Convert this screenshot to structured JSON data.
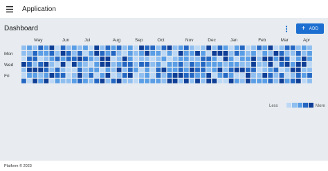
{
  "app": {
    "title": "Application",
    "menu_icon": "menu-icon"
  },
  "dashboard": {
    "title": "Dashboard",
    "more_icon": "more-vert-icon",
    "add_button": {
      "label": "ADD",
      "icon": "plus-icon",
      "color": "#1c6fd0"
    }
  },
  "heatmap": {
    "months": [
      "May",
      "Jun",
      "Jul",
      "Aug",
      "Sep",
      "Oct",
      "Nov",
      "Dec",
      "Jan",
      "Feb",
      "Mar",
      "Apr"
    ],
    "day_labels": [
      "Mon",
      "Wed",
      "Fri"
    ],
    "legend": {
      "less": "Less",
      "more": "More"
    },
    "colors": [
      "#bcd8f5",
      "#8fbef0",
      "#5a9ee6",
      "#2467c3",
      "#0e3e96"
    ],
    "weeks": 52,
    "levels": [
      [
        1,
        1,
        0,
        4,
        1,
        0,
        3
      ],
      [
        2,
        1,
        3,
        3,
        4,
        2,
        0
      ],
      [
        1,
        3,
        3,
        1,
        4,
        2,
        4
      ],
      [
        3,
        2,
        0,
        3,
        4,
        1,
        2
      ],
      [
        2,
        2,
        1,
        4,
        3,
        2,
        4
      ],
      [
        4,
        3,
        2,
        1,
        1,
        4,
        0
      ],
      [
        0,
        1,
        3,
        0,
        3,
        3,
        2
      ],
      [
        3,
        4,
        2,
        4,
        1,
        3,
        1
      ],
      [
        1,
        3,
        3,
        0,
        0,
        0,
        1
      ],
      [
        2,
        1,
        3,
        4,
        0,
        1,
        2
      ],
      [
        1,
        3,
        4,
        2,
        3,
        4,
        3
      ],
      [
        2,
        0,
        3,
        1,
        1,
        1,
        2
      ],
      [
        0,
        2,
        2,
        0,
        2,
        3,
        1
      ],
      [
        4,
        4,
        1,
        2,
        2,
        0,
        3
      ],
      [
        1,
        3,
        4,
        4,
        0,
        2,
        4
      ],
      [
        3,
        2,
        4,
        4,
        2,
        4,
        1
      ],
      [
        2,
        3,
        0,
        1,
        1,
        0,
        3
      ],
      [
        3,
        1,
        1,
        2,
        4,
        1,
        4
      ],
      [
        1,
        0,
        4,
        3,
        1,
        3,
        1
      ],
      [
        2,
        2,
        2,
        3,
        3,
        4,
        1
      ],
      [
        0,
        1,
        0,
        1,
        2,
        0,
        0
      ],
      [
        4,
        2,
        1,
        3,
        0,
        1,
        2
      ],
      [
        3,
        4,
        1,
        3,
        2,
        2,
        2
      ],
      [
        3,
        2,
        0,
        1,
        0,
        0,
        2
      ],
      [
        1,
        2,
        1,
        2,
        3,
        3,
        2
      ],
      [
        3,
        0,
        2,
        0,
        4,
        1,
        1
      ],
      [
        4,
        2,
        0,
        2,
        2,
        3,
        4
      ],
      [
        1,
        0,
        1,
        2,
        2,
        4,
        4
      ],
      [
        2,
        4,
        2,
        3,
        3,
        4,
        1
      ],
      [
        3,
        2,
        2,
        1,
        2,
        3,
        4
      ],
      [
        1,
        2,
        1,
        3,
        4,
        3,
        1
      ],
      [
        0,
        4,
        1,
        2,
        3,
        2,
        4
      ],
      [
        1,
        2,
        3,
        3,
        3,
        2,
        1
      ],
      [
        4,
        0,
        3,
        2,
        1,
        4,
        4
      ],
      [
        1,
        4,
        2,
        2,
        2,
        0,
        4
      ],
      [
        3,
        4,
        0,
        2,
        4,
        2,
        0
      ],
      [
        2,
        4,
        4,
        1,
        1,
        3,
        0
      ],
      [
        0,
        1,
        2,
        2,
        3,
        2,
        4
      ],
      [
        2,
        3,
        0,
        2,
        4,
        0,
        2
      ],
      [
        3,
        2,
        2,
        1,
        4,
        0,
        1
      ],
      [
        0,
        1,
        2,
        1,
        3,
        4,
        4
      ],
      [
        1,
        2,
        4,
        4,
        3,
        1,
        2
      ],
      [
        3,
        0,
        1,
        1,
        0,
        1,
        2
      ],
      [
        2,
        2,
        4,
        1,
        1,
        4,
        2
      ],
      [
        4,
        1,
        4,
        4,
        2,
        3,
        3
      ],
      [
        0,
        4,
        2,
        0,
        3,
        1,
        1
      ],
      [
        1,
        3,
        4,
        3,
        0,
        3,
        4
      ],
      [
        3,
        1,
        3,
        4,
        1,
        0,
        2
      ],
      [
        3,
        1,
        0,
        2,
        4,
        1,
        3
      ],
      [
        1,
        3,
        2,
        4,
        4,
        3,
        4
      ],
      [
        2,
        1,
        4,
        4,
        1,
        2,
        0
      ],
      [
        1,
        2,
        2,
        0,
        1,
        3,
        1
      ]
    ]
  },
  "footer": {
    "text": "Platform © 2023"
  }
}
